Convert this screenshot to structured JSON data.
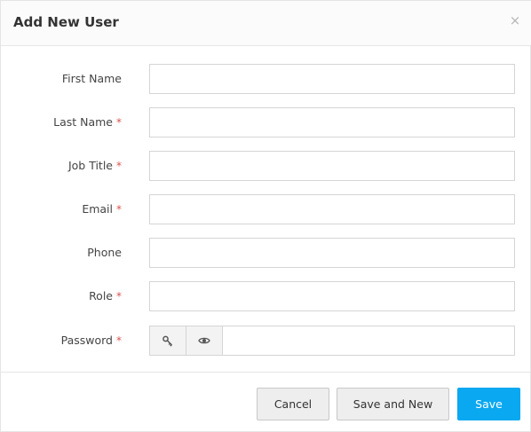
{
  "dialog": {
    "title": "Add New User",
    "close_glyph": "×"
  },
  "form": {
    "required_marker": "*",
    "fields": [
      {
        "label": "First Name",
        "required": false,
        "value": ""
      },
      {
        "label": "Last Name",
        "required": true,
        "value": ""
      },
      {
        "label": "Job Title",
        "required": true,
        "value": ""
      },
      {
        "label": "Email",
        "required": true,
        "value": ""
      },
      {
        "label": "Phone",
        "required": false,
        "value": ""
      },
      {
        "label": "Role",
        "required": true,
        "value": ""
      },
      {
        "label": "Password",
        "required": true,
        "value": ""
      }
    ],
    "password_addons": [
      "key-icon",
      "eye-icon"
    ]
  },
  "footer": {
    "cancel_label": "Cancel",
    "save_new_label": "Save and New",
    "save_label": "Save"
  },
  "colors": {
    "primary": "#0aa8f0",
    "required": "#d9534f"
  }
}
